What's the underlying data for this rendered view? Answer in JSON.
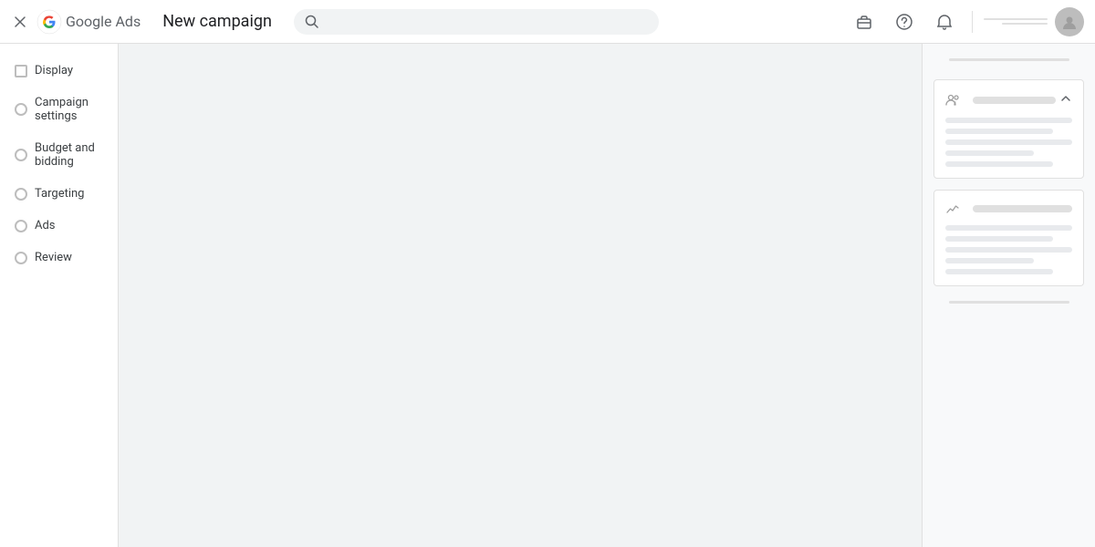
{
  "header": {
    "brand": "Google Ads",
    "page_title": "New campaign",
    "search_placeholder": ""
  },
  "topbar_icons": {
    "close": "×",
    "briefcase": "💼",
    "help": "?",
    "bell": "🔔"
  },
  "sidebar": {
    "items": [
      {
        "id": "display",
        "label": "Display",
        "type": "box"
      },
      {
        "id": "campaign-settings",
        "label": "Campaign settings",
        "type": "radio"
      },
      {
        "id": "budget-bidding",
        "label": "Budget and bidding",
        "type": "radio"
      },
      {
        "id": "targeting",
        "label": "Targeting",
        "type": "radio"
      },
      {
        "id": "ads",
        "label": "Ads",
        "type": "radio"
      },
      {
        "id": "review",
        "label": "Review",
        "type": "radio"
      }
    ]
  },
  "right_panel": {
    "card1": {
      "icon": "person",
      "has_chevron": true
    },
    "card2": {
      "icon": "chart"
    }
  }
}
